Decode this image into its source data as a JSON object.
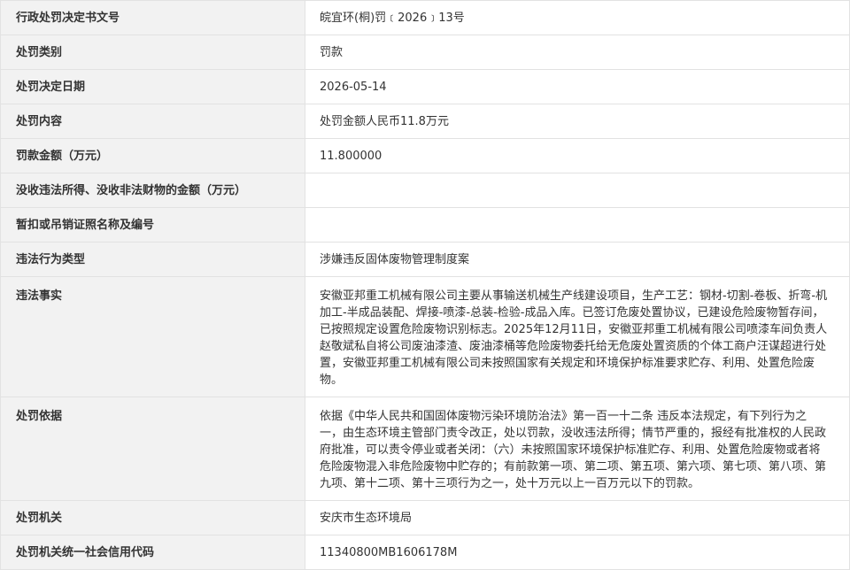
{
  "rows": [
    {
      "label": "行政处罚决定书文号",
      "value": "皖宜环(桐)罚﹝2026﹞13号"
    },
    {
      "label": "处罚类别",
      "value": "罚款"
    },
    {
      "label": "处罚决定日期",
      "value": "2026-05-14"
    },
    {
      "label": "处罚内容",
      "value": "处罚金额人民币11.8万元"
    },
    {
      "label": "罚款金额（万元）",
      "value": "11.800000"
    },
    {
      "label": "没收违法所得、没收非法财物的金额（万元）",
      "value": ""
    },
    {
      "label": "暂扣或吊销证照名称及编号",
      "value": ""
    },
    {
      "label": "违法行为类型",
      "value": "涉嫌违反固体废物管理制度案"
    },
    {
      "label": "违法事实",
      "value": "安徽亚邦重工机械有限公司主要从事输送机械生产线建设项目，生产工艺：钢材-切割-卷板、折弯-机加工-半成品装配、焊接-喷漆-总装-检验-成品入库。已签订危废处置协议，已建设危险废物暂存间，已按照规定设置危险废物识别标志。2025年12月11日，安徽亚邦重工机械有限公司喷漆车间负责人赵敬斌私自将公司废油漆渣、废油漆桶等危险废物委托给无危废处置资质的个体工商户汪谋超进行处置，安徽亚邦重工机械有限公司未按照国家有关规定和环境保护标准要求贮存、利用、处置危险废物。"
    },
    {
      "label": "处罚依据",
      "value": "依据《中华人民共和国固体废物污染环境防治法》第一百一十二条 违反本法规定，有下列行为之一，由生态环境主管部门责令改正，处以罚款，没收违法所得；情节严重的，报经有批准权的人民政府批准，可以责令停业或者关闭：（六）未按照国家环境保护标准贮存、利用、处置危险废物或者将危险废物混入非危险废物中贮存的；有前款第一项、第二项、第五项、第六项、第七项、第八项、第九项、第十二项、第十三项行为之一，处十万元以上一百万元以下的罚款。"
    },
    {
      "label": "处罚机关",
      "value": "安庆市生态环境局"
    },
    {
      "label": "处罚机关统一社会信用代码",
      "value": "11340800MB1606178M"
    }
  ]
}
